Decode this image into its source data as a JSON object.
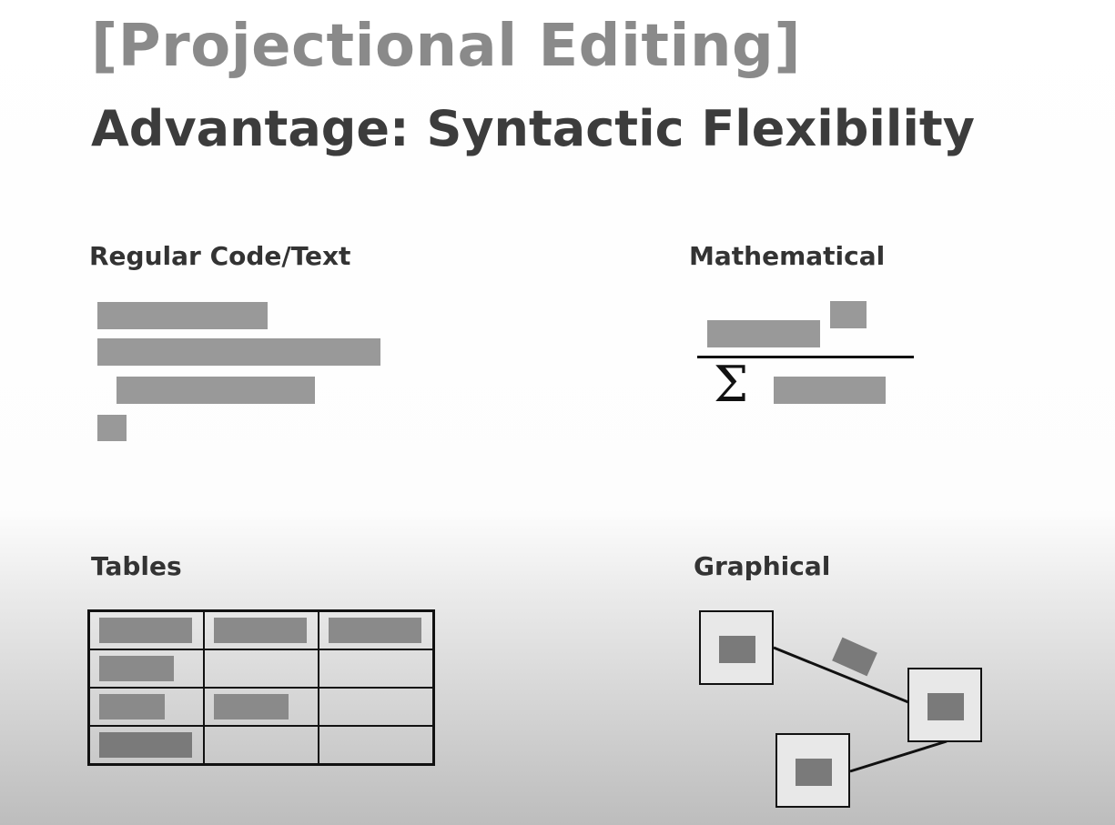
{
  "slide": {
    "title": "[Projectional Editing]",
    "subtitle": "Advantage: Syntactic Flexibility"
  },
  "sections": {
    "regular": {
      "label": "Regular Code/Text"
    },
    "math": {
      "label": "Mathematical",
      "symbol": "Σ"
    },
    "tables": {
      "label": "Tables"
    },
    "graphical": {
      "label": "Graphical"
    }
  },
  "colors": {
    "title": "#8a8a8a",
    "subtitle": "#3c3c3c",
    "placeholder_bar": "#999999",
    "line": "#111111"
  }
}
